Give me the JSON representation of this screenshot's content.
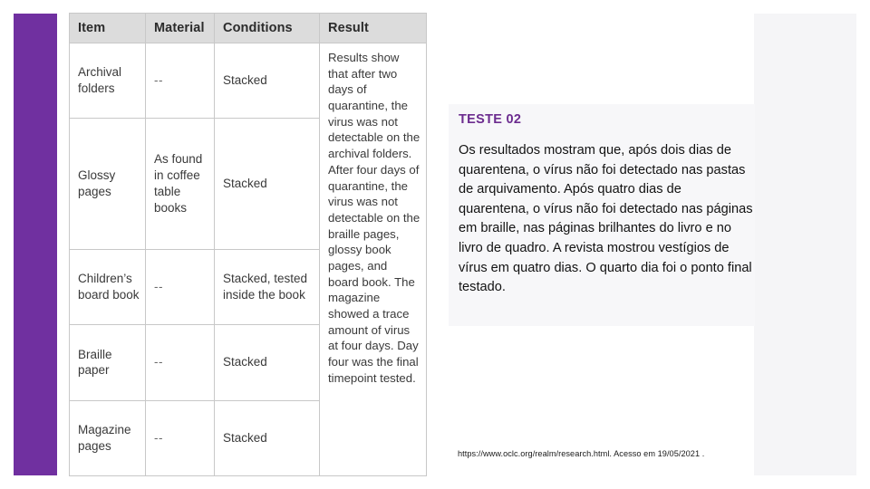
{
  "slide": {
    "accent_color": "#7030A0",
    "background_color": "#FFFFFF",
    "panel_color": "#F5F5F7"
  },
  "table": {
    "headers": [
      "Item",
      "Material",
      "Conditions",
      "Result"
    ],
    "rows": [
      {
        "item": "Archival folders",
        "material": "--",
        "conditions": "Stacked"
      },
      {
        "item": "Glossy pages",
        "material": "As found in coffee table books",
        "conditions": "Stacked"
      },
      {
        "item": "Children’s board book",
        "material": "--",
        "conditions": "Stacked, tested inside the book"
      },
      {
        "item": "Braille paper",
        "material": "--",
        "conditions": "Stacked"
      },
      {
        "item": "Magazine pages",
        "material": "--",
        "conditions": "Stacked"
      }
    ],
    "result": "Results show that after two days of quarantine, the virus was not detectable on the archival folders. After four days of quarantine, the virus was not detectable on the braille pages, glossy book pages, and board book. The magazine showed a trace amount of virus at four days. Day four was the final timepoint tested."
  },
  "teste_block": {
    "heading": "TESTE 02",
    "heading_color": "#6C2C8F",
    "body": "Os resultados mostram que, após dois dias de quarentena, o vírus não foi detectado nas pastas de arquivamento. Após quatro dias de quarentena, o vírus não foi detectado nas páginas em braille, nas páginas brilhantes do livro e no livro de quadro. A revista mostrou vestígios de vírus em quatro dias. O quarto dia foi o ponto final testado."
  },
  "source": {
    "text": "https://www.oclc.org/realm/research.html. Acesso em 19/05/2021 ."
  }
}
